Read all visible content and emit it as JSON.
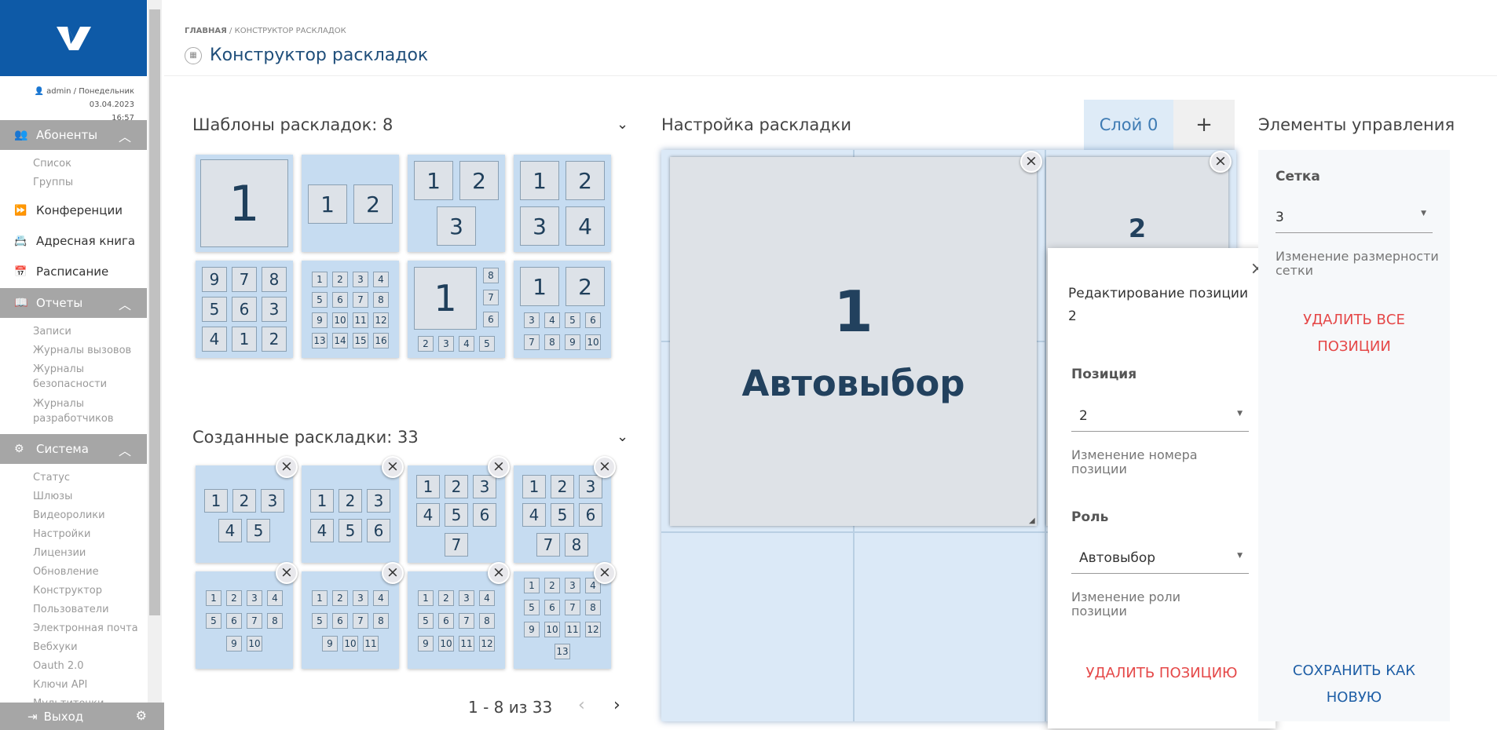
{
  "sidebar": {
    "user_line": "admin / Понедельник 03.04.2023",
    "time": "16:57",
    "sections": [
      {
        "label": "Абоненты",
        "icon": "users-icon",
        "items": [
          "Список",
          "Группы"
        ]
      },
      {
        "label": "Отчеты",
        "icon": "book-icon",
        "items": [
          "Записи",
          "Журналы вызовов",
          "Журналы безопасности",
          "Журналы разработчиков"
        ]
      },
      {
        "label": "Система",
        "icon": "cogs-icon",
        "items": [
          "Статус",
          "Шлюзы",
          "Видеоролики",
          "Настройки",
          "Лицензии",
          "Обновление",
          "Конструктор",
          "Пользователи",
          "Электронная почта",
          "Вебхуки",
          "Oauth 2.0",
          "Ключи API",
          "Мультиточки"
        ]
      }
    ],
    "nav": [
      {
        "label": "Конференции",
        "icon": "forward-icon"
      },
      {
        "label": "Адресная книга",
        "icon": "address-book-icon"
      },
      {
        "label": "Расписание",
        "icon": "calendar-icon"
      }
    ],
    "exit_label": "Выход"
  },
  "header": {
    "breadcrumb_home": "ГЛАВНАЯ",
    "breadcrumb_current": "/ КОНСТРУКТОР РАСКЛАДОК",
    "title": "Конструктор раскладок"
  },
  "templates": {
    "title": "Шаблоны раскладок: 8"
  },
  "created": {
    "title": "Созданные раскладки: 33",
    "pagination": "1 - 8 из 33"
  },
  "editor": {
    "title": "Настройка раскладки",
    "layer_tab": "Слой 0",
    "add_label": "+",
    "position1_num": "1",
    "position1_role": "Автовыбор",
    "position2_num": "2"
  },
  "edit_dialog": {
    "title": "Редактирование позиции",
    "position_number": "2",
    "position_label": "Позиция",
    "position_value": "2",
    "position_hint": "Изменение номера позиции",
    "role_label": "Роль",
    "role_value": "Автовыбор",
    "role_hint": "Изменение роли позиции",
    "delete_label": "УДАЛИТЬ ПОЗИЦИЮ"
  },
  "controls": {
    "title": "Элементы управления",
    "grid_label": "Сетка",
    "grid_value": "3",
    "grid_hint": "Изменение размерности сетки",
    "delete_all": "УДАЛИТЬ ВСЕ ПОЗИЦИИ",
    "save_new": "СОХРАНИТЬ КАК НОВУЮ"
  },
  "colors": {
    "brand": "#0e5aa7",
    "section_bg": "#a6a6a6",
    "thumb_bg": "#c6dcf1",
    "danger": "#e54848",
    "link": "#1f5fa6"
  },
  "thumbs": [
    [
      "1"
    ],
    [
      "1",
      "2"
    ],
    [
      "1",
      "2",
      "3"
    ],
    [
      "1",
      "2",
      "3",
      "4"
    ],
    [
      "9",
      "7",
      "8",
      "5",
      "6",
      "3",
      "4",
      "1",
      "2"
    ],
    [
      "1",
      "2",
      "3",
      "4",
      "5",
      "6",
      "7",
      "8",
      "9",
      "10",
      "11",
      "12",
      "13",
      "14",
      "15",
      "16"
    ],
    [
      "1",
      "8",
      "7",
      "6",
      "2",
      "3",
      "4",
      "5"
    ],
    [
      "1",
      "2",
      "3",
      "4",
      "5",
      "6",
      "7",
      "8",
      "9",
      "10"
    ],
    [
      "1",
      "2",
      "3",
      "4",
      "5"
    ],
    [
      "1",
      "2",
      "3",
      "4",
      "5",
      "6"
    ],
    [
      "1",
      "2",
      "3",
      "4",
      "5",
      "6",
      "7"
    ],
    [
      "1",
      "2",
      "3",
      "4",
      "5",
      "6",
      "7",
      "8"
    ],
    [
      "1",
      "2",
      "3",
      "4",
      "5",
      "6",
      "7",
      "8",
      "9",
      "10"
    ],
    [
      "1",
      "2",
      "3",
      "4",
      "5",
      "6",
      "7",
      "8",
      "9",
      "10",
      "11"
    ],
    [
      "1",
      "2",
      "3",
      "4",
      "5",
      "6",
      "7",
      "8",
      "9",
      "10",
      "11",
      "12"
    ],
    [
      "1",
      "2",
      "3",
      "4",
      "5",
      "6",
      "7",
      "8",
      "9",
      "10",
      "11",
      "12",
      "13"
    ]
  ]
}
